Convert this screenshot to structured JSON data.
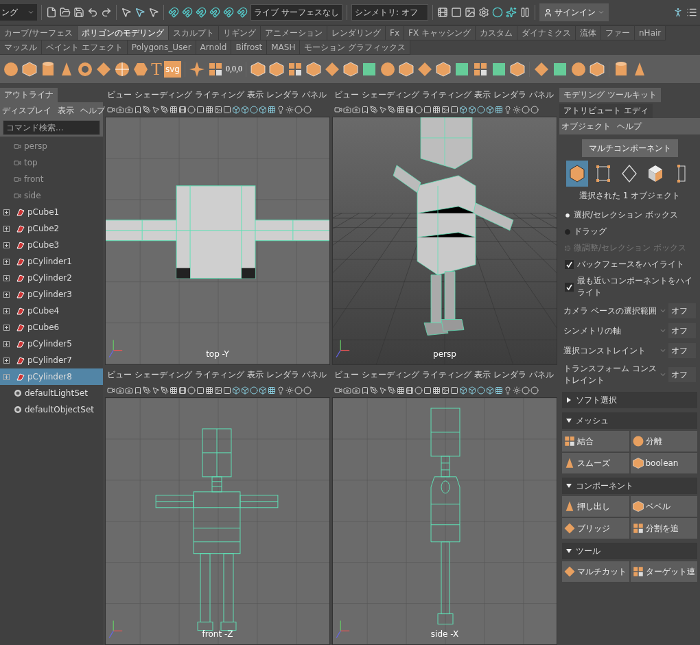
{
  "toolbar": {
    "mode_menu": "ング",
    "live_surface": "ライブ サーフェスなし",
    "symmetry": "シンメトリ: オフ",
    "sign_in": "サインイン"
  },
  "shelf_tabs": [
    {
      "label": "カーブ/サーフェス",
      "selected": false
    },
    {
      "label": "ポリゴンのモデリング",
      "selected": true
    },
    {
      "label": "スカルプト",
      "selected": false
    },
    {
      "label": "リギング",
      "selected": false
    },
    {
      "label": "アニメーション",
      "selected": false
    },
    {
      "label": "レンダリング",
      "selected": false
    },
    {
      "label": "Fx",
      "selected": false
    },
    {
      "label": "FX キャッシング",
      "selected": false
    },
    {
      "label": "カスタム",
      "selected": false
    },
    {
      "label": "ダイナミクス",
      "selected": false
    },
    {
      "label": "流体",
      "selected": false
    },
    {
      "label": "ファー",
      "selected": false
    },
    {
      "label": "nHair",
      "selected": false
    },
    {
      "label": "マッスル",
      "selected": false
    },
    {
      "label": "ペイント エフェクト",
      "selected": false
    },
    {
      "label": "Polygons_User",
      "selected": false
    },
    {
      "label": "Arnold",
      "selected": false
    },
    {
      "label": "Bifrost",
      "selected": false
    },
    {
      "label": "MASH",
      "selected": false
    },
    {
      "label": "モーション グラフィックス",
      "selected": false
    }
  ],
  "shelf": {
    "text_icons": [
      "T",
      "svg",
      "0,0,0"
    ]
  },
  "outliner": {
    "tab": "アウトライナ",
    "menu": [
      "ディスプレイ",
      "表示",
      "ヘルプ"
    ],
    "search": {
      "placeholder": "コマンド検索..."
    },
    "items": [
      {
        "label": "persp",
        "kind": "camera",
        "selected": false
      },
      {
        "label": "top",
        "kind": "camera",
        "selected": false
      },
      {
        "label": "front",
        "kind": "camera",
        "selected": false
      },
      {
        "label": "side",
        "kind": "camera",
        "selected": false
      },
      {
        "label": "pCube1",
        "kind": "mesh",
        "selected": false
      },
      {
        "label": "pCube2",
        "kind": "mesh",
        "selected": false
      },
      {
        "label": "pCube3",
        "kind": "mesh",
        "selected": false
      },
      {
        "label": "pCylinder1",
        "kind": "mesh",
        "selected": false
      },
      {
        "label": "pCylinder2",
        "kind": "mesh",
        "selected": false
      },
      {
        "label": "pCylinder3",
        "kind": "mesh",
        "selected": false
      },
      {
        "label": "pCube4",
        "kind": "mesh",
        "selected": false
      },
      {
        "label": "pCube6",
        "kind": "mesh",
        "selected": false
      },
      {
        "label": "pCylinder5",
        "kind": "mesh",
        "selected": false
      },
      {
        "label": "pCylinder7",
        "kind": "mesh",
        "selected": false
      },
      {
        "label": "pCylinder8",
        "kind": "mesh",
        "selected": true
      },
      {
        "label": "defaultLightSet",
        "kind": "set",
        "selected": false
      },
      {
        "label": "defaultObjectSet",
        "kind": "set",
        "selected": false
      }
    ]
  },
  "viewports": [
    {
      "menu": [
        "ビュー",
        "シェーディング",
        "ライティング",
        "表示",
        "レンダラ",
        "パネル"
      ],
      "label": "top -Y",
      "kind": "top"
    },
    {
      "menu": [
        "ビュー",
        "シェーディング",
        "ライティング",
        "表示",
        "レンダラ",
        "パネル"
      ],
      "label": "persp",
      "kind": "persp"
    },
    {
      "menu": [
        "ビュー",
        "シェーディング",
        "ライティング",
        "表示",
        "レンダラ",
        "パネル"
      ],
      "label": "front -Z",
      "kind": "front"
    },
    {
      "menu": [
        "ビュー",
        "シェーディング",
        "ライティング",
        "表示",
        "レンダラ",
        "パネル"
      ],
      "label": "side -X",
      "kind": "side"
    }
  ],
  "toolkit": {
    "tabs": [
      {
        "label": "モデリング ツールキット",
        "selected": true
      },
      {
        "label": "アトリビュート エディ",
        "selected": false
      }
    ],
    "menu": [
      "オブジェクト",
      "ヘルプ"
    ],
    "mode_button": "マルチコンポーネント",
    "components": [
      {
        "kind": "object",
        "selected": true
      },
      {
        "kind": "vertex",
        "selected": false
      },
      {
        "kind": "edge",
        "selected": false
      },
      {
        "kind": "face",
        "selected": false
      },
      {
        "kind": "uv",
        "selected": false
      }
    ],
    "selection_info": "選択された 1 オブジェクト",
    "radios": [
      {
        "label": "選択/セレクション ボックス",
        "selected": true,
        "disabled": false
      },
      {
        "label": "ドラッグ",
        "selected": false,
        "disabled": false
      },
      {
        "label": "微調整/セレクション ボックス",
        "selected": false,
        "disabled": true
      }
    ],
    "checks": [
      {
        "label": "バックフェースをハイライト",
        "checked": true
      },
      {
        "label": "最も近いコンポーネントをハイライト",
        "checked": true
      }
    ],
    "dropdowns": [
      {
        "label": "カメラ ベースの選択範囲",
        "value": "オフ"
      },
      {
        "label": "シンメトリの軸",
        "value": "オフ"
      },
      {
        "label": "選択コンストレイント",
        "value": "オフ"
      },
      {
        "label": "トランスフォーム コンストレイント",
        "value": "オフ"
      }
    ],
    "sections": [
      {
        "title": "ソフト選択",
        "expanded": false
      },
      {
        "title": "メッシュ",
        "expanded": true,
        "buttons": [
          "結合",
          "分離",
          "スムーズ",
          "boolean"
        ]
      },
      {
        "title": "コンポーネント",
        "expanded": true,
        "buttons": [
          "押し出し",
          "ベベル",
          "ブリッジ",
          "分割を追"
        ]
      },
      {
        "title": "ツール",
        "expanded": true,
        "buttons": [
          "マルチカット",
          "ターゲット連"
        ]
      }
    ]
  }
}
